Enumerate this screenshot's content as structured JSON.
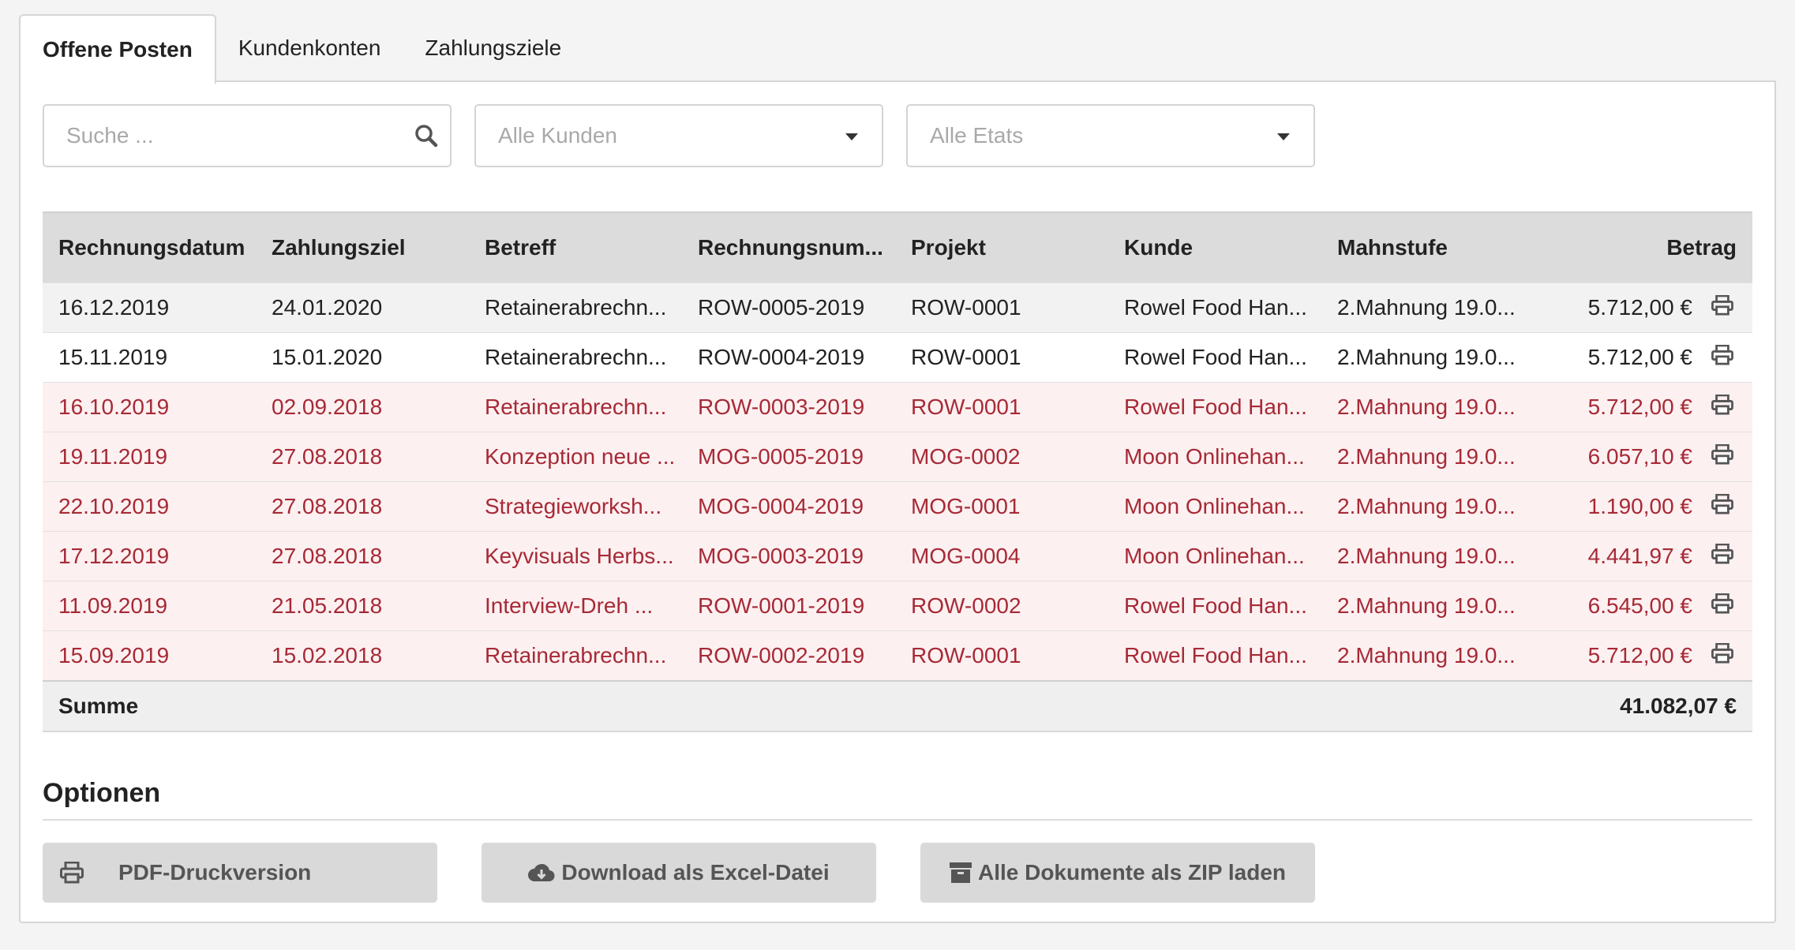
{
  "tabs": [
    {
      "label": "Offene Posten",
      "active": true
    },
    {
      "label": "Kundenkonten",
      "active": false
    },
    {
      "label": "Zahlungsziele",
      "active": false
    }
  ],
  "filters": {
    "search_placeholder": "Suche ...",
    "customer_select": "Alle Kunden",
    "budget_select": "Alle Etats"
  },
  "table": {
    "columns": [
      "Rechnungsdatum",
      "Zahlungsziel",
      "Betreff",
      "Rechnungsnum...",
      "Projekt",
      "Kunde",
      "Mahnstufe",
      "Betrag"
    ],
    "rows": [
      {
        "datum": "16.12.2019",
        "ziel": "24.01.2020",
        "betreff": "Retainerabrechn...",
        "nummer": "ROW-0005-2019",
        "projekt": "ROW-0001",
        "kunde": "Rowel Food Han...",
        "mahnstufe": "2.Mahnung 19.0...",
        "betrag": "5.712,00 €",
        "overdue": false
      },
      {
        "datum": "15.11.2019",
        "ziel": "15.01.2020",
        "betreff": "Retainerabrechn...",
        "nummer": "ROW-0004-2019",
        "projekt": "ROW-0001",
        "kunde": "Rowel Food Han...",
        "mahnstufe": "2.Mahnung 19.0...",
        "betrag": "5.712,00 €",
        "overdue": false
      },
      {
        "datum": "16.10.2019",
        "ziel": "02.09.2018",
        "betreff": "Retainerabrechn...",
        "nummer": "ROW-0003-2019",
        "projekt": "ROW-0001",
        "kunde": "Rowel Food Han...",
        "mahnstufe": "2.Mahnung 19.0...",
        "betrag": "5.712,00 €",
        "overdue": true
      },
      {
        "datum": "19.11.2019",
        "ziel": "27.08.2018",
        "betreff": "Konzeption neue ...",
        "nummer": "MOG-0005-2019",
        "projekt": "MOG-0002",
        "kunde": "Moon Onlinehan...",
        "mahnstufe": "2.Mahnung 19.0...",
        "betrag": "6.057,10 €",
        "overdue": true
      },
      {
        "datum": "22.10.2019",
        "ziel": "27.08.2018",
        "betreff": "Strategieworksh...",
        "nummer": "MOG-0004-2019",
        "projekt": "MOG-0001",
        "kunde": "Moon Onlinehan...",
        "mahnstufe": "2.Mahnung 19.0...",
        "betrag": "1.190,00 €",
        "overdue": true
      },
      {
        "datum": "17.12.2019",
        "ziel": "27.08.2018",
        "betreff": "Keyvisuals Herbs...",
        "nummer": "MOG-0003-2019",
        "projekt": "MOG-0004",
        "kunde": "Moon Onlinehan...",
        "mahnstufe": "2.Mahnung 19.0...",
        "betrag": "4.441,97 €",
        "overdue": true
      },
      {
        "datum": "11.09.2019",
        "ziel": "21.05.2018",
        "betreff": "Interview-Dreh ...",
        "nummer": "ROW-0001-2019",
        "projekt": "ROW-0002",
        "kunde": "Rowel Food Han...",
        "mahnstufe": "2.Mahnung 19.0...",
        "betrag": "6.545,00 €",
        "overdue": true
      },
      {
        "datum": "15.09.2019",
        "ziel": "15.02.2018",
        "betreff": "Retainerabrechn...",
        "nummer": "ROW-0002-2019",
        "projekt": "ROW-0001",
        "kunde": "Rowel Food Han...",
        "mahnstufe": "2.Mahnung 19.0...",
        "betrag": "5.712,00 €",
        "overdue": true
      }
    ],
    "sum_label": "Summe",
    "sum_value": "41.082,07 €"
  },
  "options": {
    "title": "Optionen",
    "pdf_label": "PDF-Druckversion",
    "excel_label": "Download als Excel-Datei",
    "zip_label": "Alle Dokumente als ZIP laden"
  },
  "colors": {
    "overdue_text": "#a62a36",
    "overdue_bg": "#fdf0f1",
    "header_bg": "#dcdcdc",
    "button_bg": "#d9d9d9"
  }
}
